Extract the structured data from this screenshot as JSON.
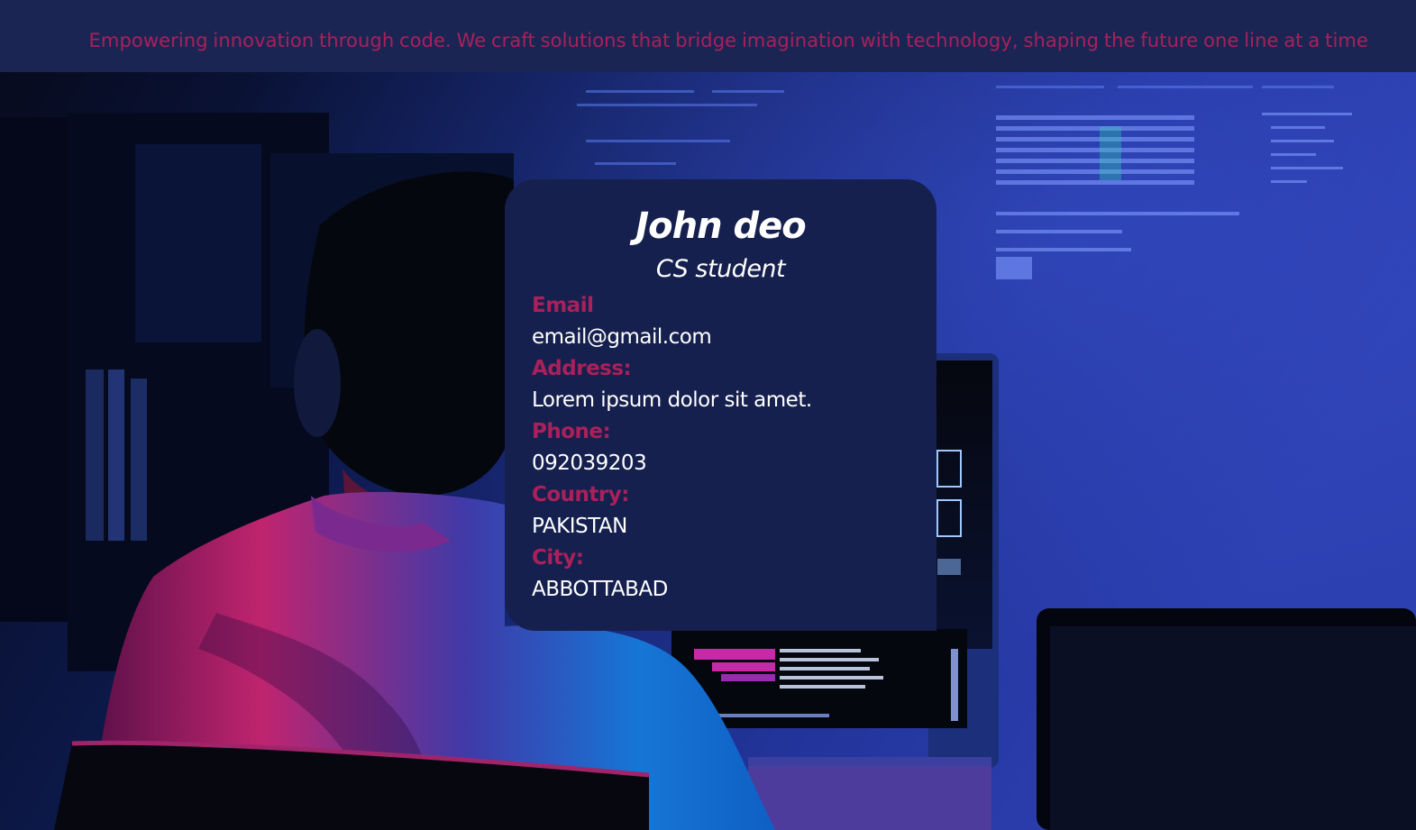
{
  "banner": {
    "tagline": "Empowering innovation through code. We craft solutions that bridge imagination with technology, shaping the future one line at a time"
  },
  "background": {
    "image": "developer-at-computer-photo"
  },
  "card": {
    "name": "John deo",
    "role": "CS student",
    "fields": [
      {
        "label": "Email",
        "value": "email@gmail.com"
      },
      {
        "label": "Address:",
        "value": "Lorem ipsum dolor sit amet."
      },
      {
        "label": "Phone:",
        "value": "092039203"
      },
      {
        "label": "Country:",
        "value": "PAKISTAN"
      },
      {
        "label": "City:",
        "value": "ABBOTTABAD"
      }
    ]
  },
  "colors": {
    "banner_bg": "#1b2554",
    "accent": "#a8215a",
    "card_bg": "#16204e",
    "text": "#ffffff"
  }
}
